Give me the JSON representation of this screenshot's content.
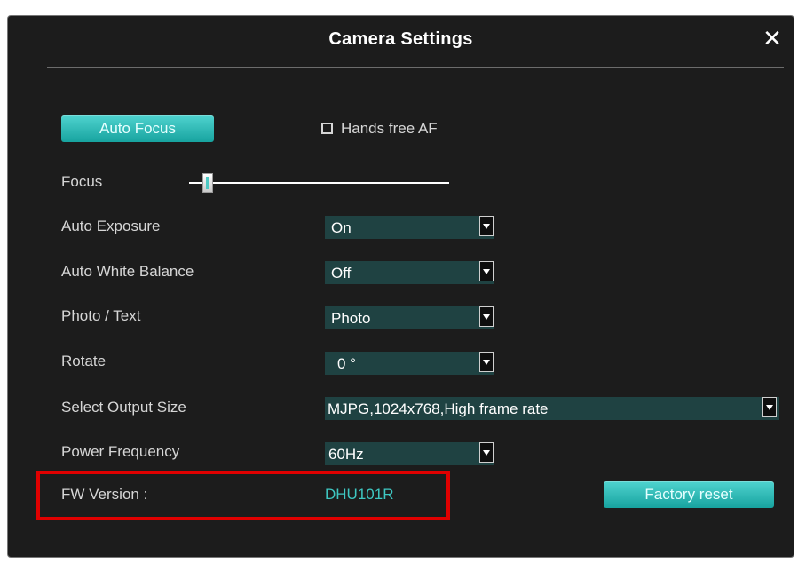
{
  "dialog": {
    "title": "Camera Settings",
    "close_icon": "close-icon"
  },
  "auto_focus_button": "Auto Focus",
  "hands_free": {
    "label": "Hands free AF",
    "checked": false
  },
  "focus": {
    "label": "Focus",
    "level_fraction": 0.07
  },
  "rows": [
    {
      "label": "Auto Exposure",
      "value": "On"
    },
    {
      "label": "Auto White Balance",
      "value": "Off"
    },
    {
      "label": "Photo / Text",
      "value": "Photo"
    },
    {
      "label": "Rotate",
      "value": "0 °"
    },
    {
      "label": "Select Output Size",
      "value": "MJPG,1024x768,High frame rate"
    },
    {
      "label": "Power Frequency",
      "value": "60Hz"
    }
  ],
  "fw": {
    "label": "FW Version :",
    "value": "DHU101R"
  },
  "factory_reset_button": "Factory reset",
  "colors": {
    "accent": "#2bbab6",
    "highlight": "#e00000",
    "background": "#1c1c1c"
  }
}
